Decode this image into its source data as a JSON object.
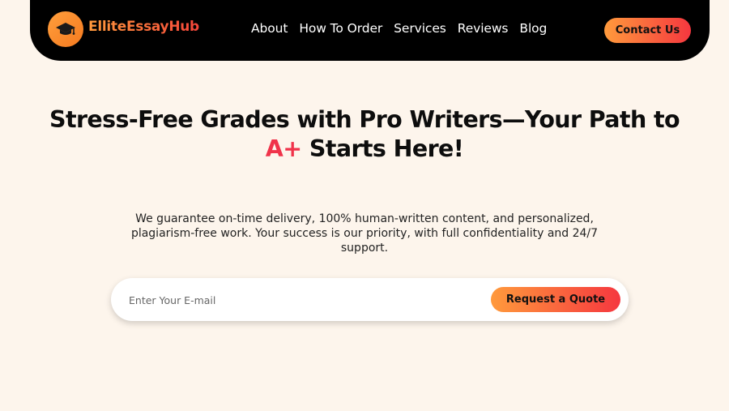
{
  "brand": {
    "name": "ElliteEssayHub",
    "logo_icon": "graduation-cap-icon",
    "accent_from": "#ff9a3c",
    "accent_to": "#f5373f"
  },
  "nav": {
    "links": [
      "About",
      "How To Order",
      "Services",
      "Reviews",
      "Blog"
    ],
    "contact_label": "Contact Us"
  },
  "hero": {
    "title_line1": "Stress-Free Grades with Pro Writers—Your Path to",
    "title_accent": "A+",
    "title_line2_rest": " Starts Here!",
    "subtitle": "We guarantee on-time delivery, 100% human-written content, and personalized, plagiarism-free work. Your success is our priority, with full confidentiality and 24/7 support."
  },
  "form": {
    "email_placeholder": "Enter Your E-mail",
    "email_value": "",
    "submit_label": "Request a Quote"
  },
  "colors": {
    "background": "#fdf5ec",
    "navbar": "#000000",
    "accent_red": "#f0334a"
  }
}
